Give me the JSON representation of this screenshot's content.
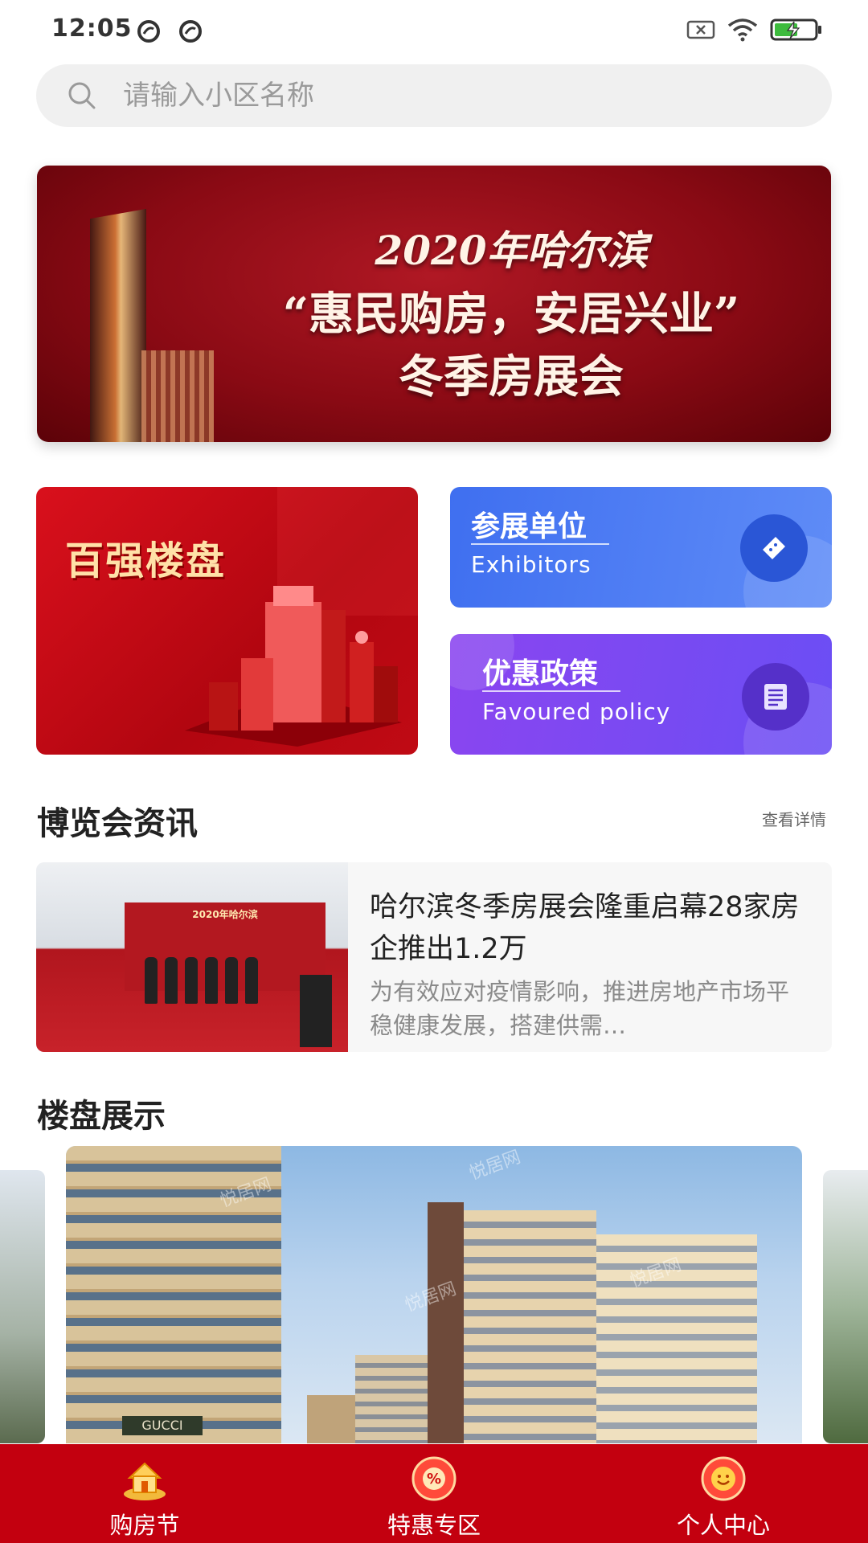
{
  "status_bar": {
    "time": "12:05"
  },
  "search": {
    "placeholder": "请输入小区名称"
  },
  "hero_banner": {
    "line1": "2020年哈尔滨",
    "line2": "“惠民购房，安居兴业”",
    "line3": "冬季房展会"
  },
  "features": {
    "top100": {
      "label": "百强楼盘"
    },
    "exhibitors": {
      "title": "参展单位",
      "subtitle": "Exhibitors",
      "icon": "ticket-icon"
    },
    "policy": {
      "title": "优惠政策",
      "subtitle": "Favoured policy",
      "icon": "document-icon"
    }
  },
  "news_section": {
    "title": "博览会资讯",
    "see_more": "查看详情",
    "item": {
      "headline": "哈尔滨冬季房展会隆重启幕28家房企推出1.2万",
      "excerpt": "为有效应对疫情影响，推进房地产市场平稳健康发展，搭建供需…",
      "thumb_caption": "2020年哈尔滨"
    }
  },
  "showcase_section": {
    "title": "楼盘展示",
    "shop_sign": "GUCCI"
  },
  "bottom_nav": {
    "items": [
      {
        "label": "购房节",
        "icon": "house-icon"
      },
      {
        "label": "特惠专区",
        "icon": "discount-icon"
      },
      {
        "label": "个人中心",
        "icon": "smiley-icon"
      }
    ]
  },
  "colors": {
    "primary_red": "#c3000f",
    "exhibitors_blue": "#4a7af3",
    "policy_purple": "#7a4af2"
  }
}
